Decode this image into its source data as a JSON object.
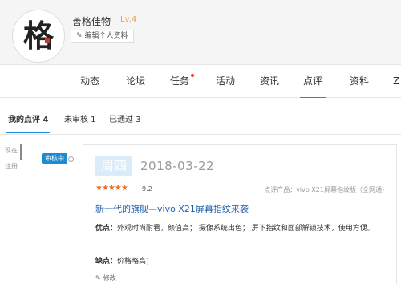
{
  "profile": {
    "avatar_char": "格",
    "username": "善格佳物",
    "level": "Lv.4",
    "edit_label": "编辑个人资料"
  },
  "nav": {
    "items": [
      "动态",
      "论坛",
      "任务",
      "活动",
      "资讯",
      "点评",
      "资料",
      "Z"
    ],
    "active": "点评"
  },
  "subtabs": {
    "items": [
      "我的点评 4",
      "未审核 1",
      "已通过 3"
    ],
    "active": "我的点评 4"
  },
  "timeline": {
    "side_labels": [
      "现在",
      "注册"
    ],
    "status": "审核中"
  },
  "review": {
    "weekday": "周四",
    "date": "2018-03-22",
    "stars": "★★★★★",
    "rating": 9.2,
    "rating_text": "9.2",
    "product": "点评产品：vivo X21屏幕指纹版（全网通）",
    "title": "新一代的旗舰—vivo X21屏幕指纹来袭",
    "pros_label": "优点：",
    "pros": "外观时尚耐看，颜值高； 摄像系统出色； 屏下指纹和面部解锁技术，使用方便。",
    "cons_label": "缺点：",
    "cons": "价格略高；",
    "edit_label": "修改"
  },
  "colors": {
    "accent": "#1f8ad1",
    "star": "#f26b1d",
    "title_link": "#1f5fa8",
    "level": "#e5a34a"
  }
}
